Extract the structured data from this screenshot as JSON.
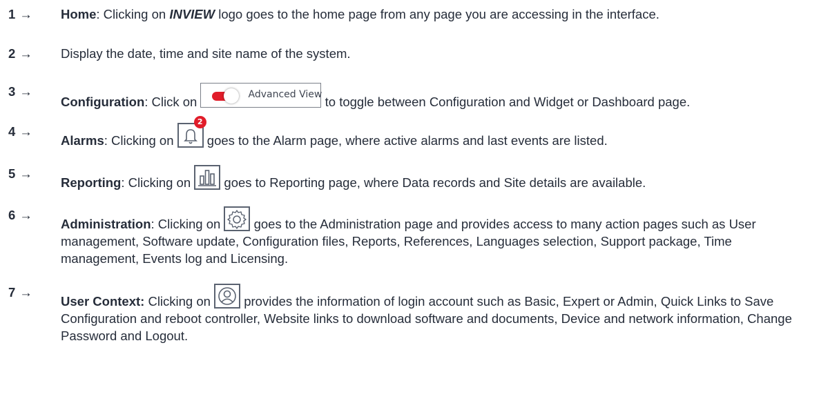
{
  "items": [
    {
      "num": "1",
      "arrow": "→",
      "title": "Home",
      "pre": ": Clicking on ",
      "brand": "INVIEW",
      "post": " logo goes to the home page from any page you are accessing in the interface."
    },
    {
      "num": "2",
      "arrow": "→",
      "text": "Display the date, time and site name of the system."
    },
    {
      "num": "3",
      "arrow": "→",
      "title": "Configuration",
      "pre": ": Click on ",
      "toggle_label": "Advanced View",
      "post": " to toggle between Configuration and Widget or Dashboard page."
    },
    {
      "num": "4",
      "arrow": "→",
      "title": "Alarms",
      "pre": ": Clicking on ",
      "badge": "2",
      "post": " goes to the Alarm page, where active alarms and last events are listed."
    },
    {
      "num": "5",
      "arrow": "→",
      "title": "Reporting",
      "pre": ": Clicking on ",
      "post": " goes to Reporting page, where Data records and Site details are available."
    },
    {
      "num": "6",
      "arrow": "→",
      "title": "Administration",
      "pre": ": Clicking on ",
      "post": " goes to the Administration page and provides access to many action pages such as User management, Software update, Configuration files, Reports, References, Languages selection, Support package, Time management, Events log and Licensing."
    },
    {
      "num": "7",
      "arrow": "→",
      "title": "User Context:",
      "pre": " Clicking on ",
      "post": " provides the information of login account such as Basic, Expert or Admin, Quick Links to Save Configuration and reboot controller, Website links to download software and documents, Device and network information, Change Password and Logout."
    }
  ],
  "colors": {
    "text": "#262d3a",
    "accent_red": "#e11d2a",
    "icon_stroke": "#5a6270"
  },
  "icons": [
    "bell-icon",
    "bar-chart-icon",
    "gear-icon",
    "user-icon",
    "toggle-switch-icon"
  ]
}
